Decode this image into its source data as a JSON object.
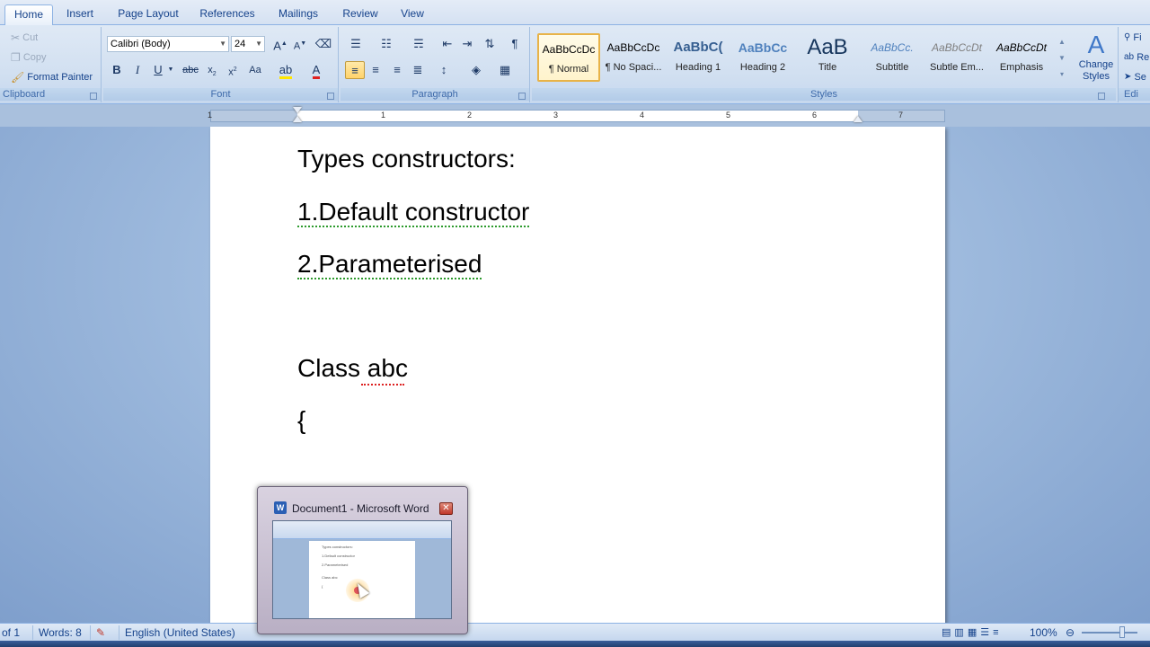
{
  "tabs": [
    "Home",
    "Insert",
    "Page Layout",
    "References",
    "Mailings",
    "Review",
    "View"
  ],
  "clipboard": {
    "cut": "Cut",
    "copy": "Copy",
    "format_painter": "Format Painter",
    "label": "Clipboard"
  },
  "font": {
    "name": "Calibri (Body)",
    "size": "24",
    "label": "Font"
  },
  "paragraph": {
    "label": "Paragraph"
  },
  "styles": {
    "label": "Styles",
    "gallery": [
      {
        "sample": "AaBbCcDc",
        "name": "¶ Normal"
      },
      {
        "sample": "AaBbCcDc",
        "name": "¶ No Spaci..."
      },
      {
        "sample": "AaBbC(",
        "name": "Heading 1"
      },
      {
        "sample": "AaBbCc",
        "name": "Heading 2"
      },
      {
        "sample": "AaB",
        "name": "Title"
      },
      {
        "sample": "AaBbCc.",
        "name": "Subtitle"
      },
      {
        "sample": "AaBbCcDt",
        "name": "Subtle Em..."
      },
      {
        "sample": "AaBbCcDt",
        "name": "Emphasis"
      }
    ],
    "change_styles_line1": "Change",
    "change_styles_line2": "Styles",
    "editing_fragments": [
      "Fi",
      "Re",
      "Se"
    ],
    "editing_label": "Edi"
  },
  "ruler": {
    "numbers": [
      "1",
      "1",
      "2",
      "3",
      "4",
      "5",
      "6",
      "7"
    ]
  },
  "document": {
    "lines": [
      "Types constructors:",
      "1.Default constructor",
      "2.Parameterised",
      "Class abc",
      "{"
    ]
  },
  "status": {
    "page": "of 1",
    "words": "Words: 8",
    "language": "English (United States)",
    "zoom": "100%"
  },
  "preview": {
    "title": "Document1 - Microsoft Word",
    "thumb_lines": [
      "Types constructors:",
      "1.Default constructor",
      "2.Parameterised",
      "Class abc",
      "{"
    ]
  },
  "colors": {
    "accent": "#15428b",
    "selected_style_border": "#e8b348",
    "spelling_squiggle": "#dd2222",
    "grammar_squiggle": "#2c9a2c"
  }
}
